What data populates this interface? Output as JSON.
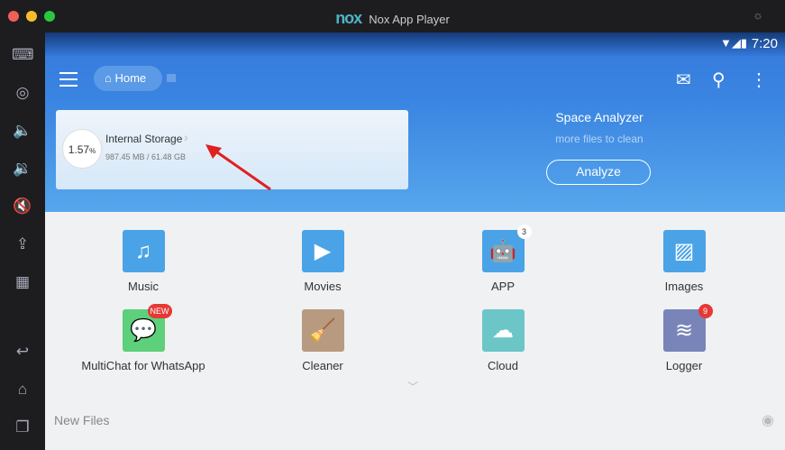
{
  "window": {
    "title": "Nox App Player",
    "logo": "nox"
  },
  "status": {
    "time": "7:20",
    "icons": "wifi-signal-battery"
  },
  "toolbar": {
    "breadcrumb": "Home"
  },
  "storage": {
    "name": "Internal Storage",
    "percent": "1.57",
    "percent_sign": "%",
    "size": "987.45 MB / 61.48 GB"
  },
  "analyzer": {
    "title": "Space Analyzer",
    "subtitle": "more files to clean",
    "button": "Analyze"
  },
  "tiles": [
    {
      "label": "Music",
      "color": "#4aa3e6",
      "glyph": "♫"
    },
    {
      "label": "Movies",
      "color": "#4aa3e6",
      "glyph": "▶"
    },
    {
      "label": "APP",
      "color": "#4aa3e6",
      "glyph": "🤖",
      "badge": "3"
    },
    {
      "label": "Images",
      "color": "#4aa3e6",
      "glyph": "▨"
    },
    {
      "label": "MultiChat for WhatsApp",
      "color": "#5ecf7a",
      "glyph": "💬",
      "badge": "NEW"
    },
    {
      "label": "Cleaner",
      "color": "#b89a80",
      "glyph": "🧹"
    },
    {
      "label": "Cloud",
      "color": "#6cc6c8",
      "glyph": "☁"
    },
    {
      "label": "Logger",
      "color": "#7985b8",
      "glyph": "≋",
      "badge": "9"
    }
  ],
  "new_files": "New Files"
}
